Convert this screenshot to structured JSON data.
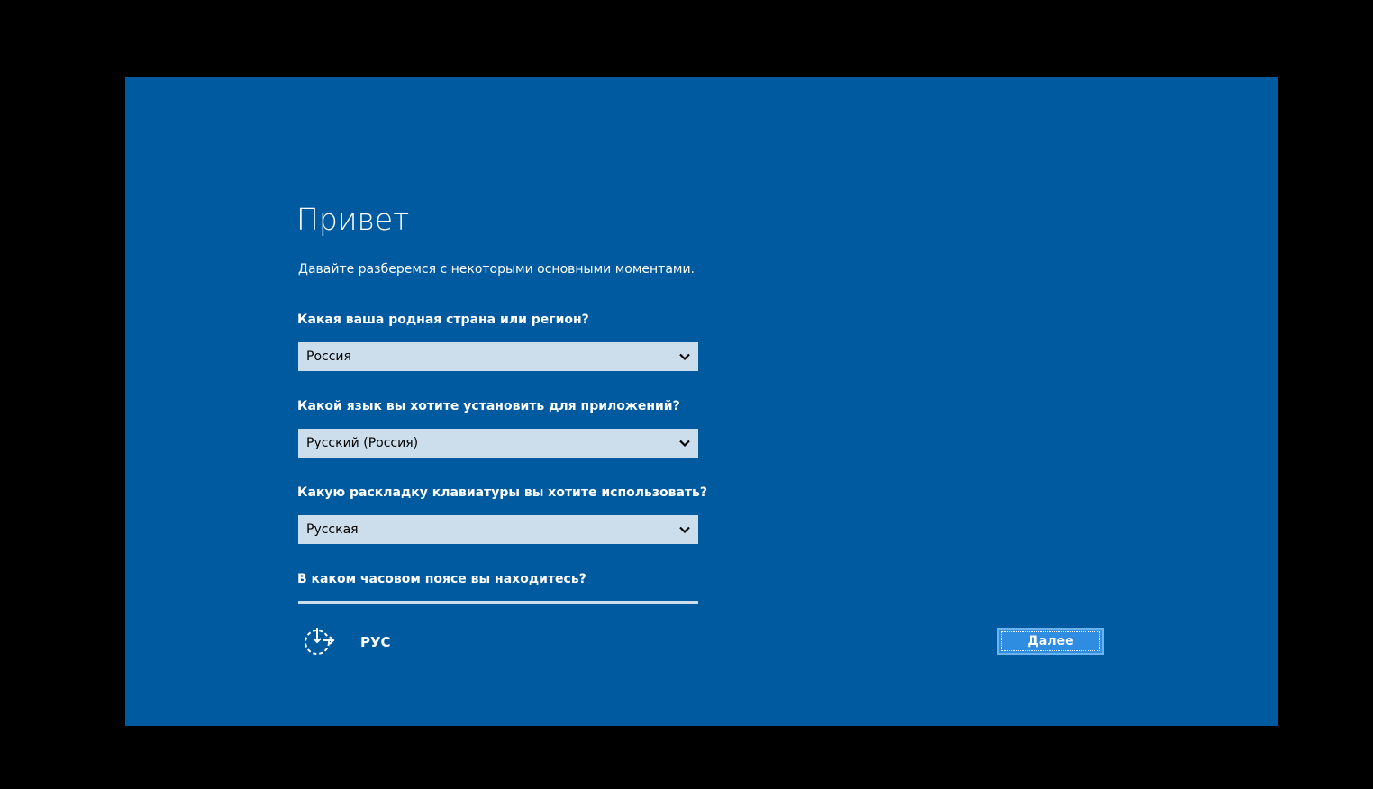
{
  "title": "Привет",
  "subtitle": "Давайте разберемся с некоторыми основными моментами.",
  "questions": {
    "region": {
      "label": "Какая ваша родная страна или регион?",
      "value": "Россия"
    },
    "app_language": {
      "label": "Какой язык вы хотите установить для приложений?",
      "value": "Русский (Россия)"
    },
    "keyboard": {
      "label": "Какую раскладку клавиатуры вы хотите использовать?",
      "value": "Русская"
    },
    "timezone": {
      "label": "В каком часовом поясе вы находитесь?"
    }
  },
  "footer": {
    "ease_of_access_icon": "ease-of-access-icon",
    "language_indicator": "РУС",
    "next_label": "Далее"
  },
  "colors": {
    "background": "#005AA0",
    "field": "#CCDEEC",
    "button": "#2E8DE0",
    "text": "#FFFFFF"
  }
}
